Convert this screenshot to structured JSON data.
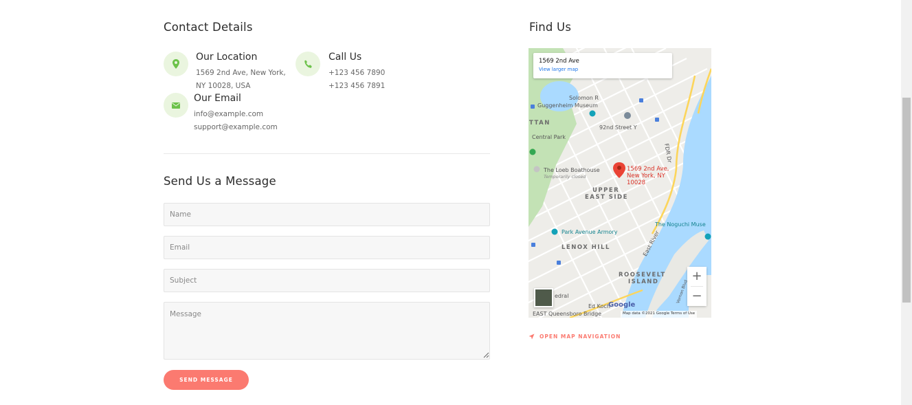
{
  "contact": {
    "title": "Contact Details",
    "location": {
      "title": "Our Location",
      "lines": [
        "1569 2nd Ave, New York,",
        "NY 10028, USA"
      ],
      "icon": "map-pin-icon"
    },
    "call": {
      "title": "Call Us",
      "lines": [
        "+123 456 7890",
        "+123 456 7891"
      ],
      "icon": "phone-icon"
    },
    "email": {
      "title": "Our Email",
      "lines": [
        "info@example.com",
        "support@example.com"
      ],
      "icon": "envelope-icon"
    },
    "icon_bg": "#eaf5df",
    "icon_color": "#6cc24a"
  },
  "form": {
    "title": "Send Us a Message",
    "name_placeholder": "Name",
    "email_placeholder": "Email",
    "subject_placeholder": "Subject",
    "message_placeholder": "Message",
    "submit_label": "SEND MESSAGE",
    "accent": "#fb7a70"
  },
  "find": {
    "title": "Find Us",
    "map": {
      "card_address": "1569 2nd Ave",
      "card_link": "View larger map",
      "pin_label": "1569 2nd Ave, New York, NY 10028",
      "labels": {
        "solomon": "Solomon R",
        "guggenheim": "Guggenheim Museum",
        "ttan": "TTAN",
        "st92": "92nd Street Y",
        "central_park": "Central Park",
        "boathouse": "The Loeb Boathouse",
        "temp_closed": "Temporarily closed",
        "upper": "UPPER",
        "east_side": "EAST SIDE",
        "noguchi": "The Noguchi Muse",
        "armory": "Park Avenue Armory",
        "lenox": "LENOX HILL",
        "roosevelt": "ROOSEVELT",
        "island": "ISLAND",
        "edral": "edral",
        "ed_koch": "Ed Koch",
        "queensboro": "EAST Queensboro Bridge",
        "fdr": "FDR Dr",
        "east_river": "East River",
        "vernon": "Vernon Blvd"
      },
      "google": "Google",
      "footer": "Map data ©2021 Google   Terms of Use",
      "zoom_in": "+",
      "zoom_out": "−"
    },
    "nav_label": "OPEN MAP NAVIGATION"
  }
}
